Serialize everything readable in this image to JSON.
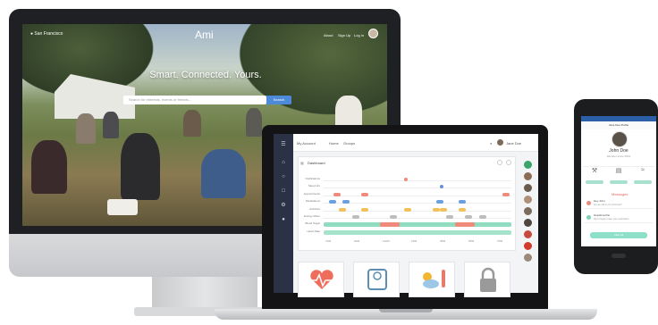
{
  "desktop": {
    "location": "San Francisco",
    "brand": "Ami",
    "nav": [
      "About",
      "Sign Up",
      "Log In"
    ],
    "hero_title": "Smart. Connected. Yours.",
    "search_placeholder": "Search for interests, events or friends...",
    "search_button": "Search"
  },
  "laptop": {
    "topbar": {
      "account": "My Account",
      "home": "Home",
      "groups": "Groups",
      "user": "Jane Doe"
    },
    "card_title": "Dashboard",
    "row_labels": [
      "Notifications",
      "Sleep Hrs",
      "Appointments",
      "Medications",
      "Activities",
      "Energy Meter",
      "Blood Sugar",
      "Heart Rate"
    ],
    "x_labels": [
      "7AM",
      "9AM",
      "11AM",
      "1PM",
      "3PM",
      "5PM",
      "7PM"
    ],
    "tiles": [
      "heart-icon",
      "scale-icon",
      "weather-icon",
      "lock-icon"
    ],
    "accent": "#4bc9a0",
    "contact_colors": [
      "#3aa56b",
      "#8a6d54",
      "#6a5a4c",
      "#b08f7a",
      "#7b6b5c",
      "#4f4640",
      "#c74a3c",
      "#d13b2c",
      "#9a8a7a"
    ]
  },
  "phone": {
    "title": "Jane Doe Profile",
    "name": "John Doe",
    "subtitle": "Member since 2015",
    "icons": [
      "tools-icon",
      "calendar-icon",
      "wifi-icon"
    ],
    "messages_heading": "Messages",
    "messages": [
      {
        "sender": "Hey John",
        "text": "Are we still on for tomorrow?"
      },
      {
        "sender": "Grandma Pat",
        "text": "Don't forget to take your medication"
      }
    ],
    "action": "View All"
  }
}
